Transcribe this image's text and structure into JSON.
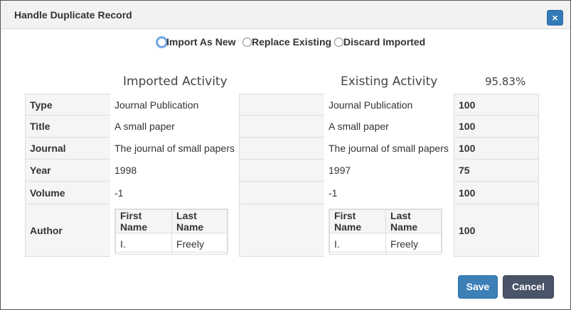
{
  "dialog": {
    "title": "Handle Duplicate Record",
    "close_label": "×"
  },
  "options": [
    {
      "label": "Import As New",
      "selected": false,
      "focused": true
    },
    {
      "label": "Replace Existing",
      "selected": false,
      "focused": false
    },
    {
      "label": "Discard Imported",
      "selected": false,
      "focused": false
    }
  ],
  "imported_title": "Imported Activity",
  "existing_title": "Existing Activity",
  "match_score": "95.83%",
  "rows": [
    {
      "label": "Type",
      "imported": "Journal Publication",
      "existing": "Journal Publication",
      "score": "100"
    },
    {
      "label": "Title",
      "imported": "A small paper",
      "existing": "A small paper",
      "score": "100"
    },
    {
      "label": "Journal",
      "imported": "The journal of small papers",
      "existing": "The journal of small papers",
      "score": "100"
    },
    {
      "label": "Year",
      "imported": "1998",
      "existing": "1997",
      "score": "75"
    },
    {
      "label": "Volume",
      "imported": "-1",
      "existing": "-1",
      "score": "100"
    },
    {
      "label": "Author",
      "score": "100"
    }
  ],
  "author_table": {
    "headers": [
      "First Name",
      "Last Name"
    ],
    "imported_rows": [
      [
        "I.",
        "Freely"
      ]
    ],
    "existing_rows": [
      [
        "I.",
        "Freely"
      ]
    ]
  },
  "buttons": {
    "save": "Save",
    "cancel": "Cancel"
  },
  "colors": {
    "primary": "#3c80b7",
    "secondary": "#4a5468",
    "focus_ring": "#7aaeea"
  }
}
